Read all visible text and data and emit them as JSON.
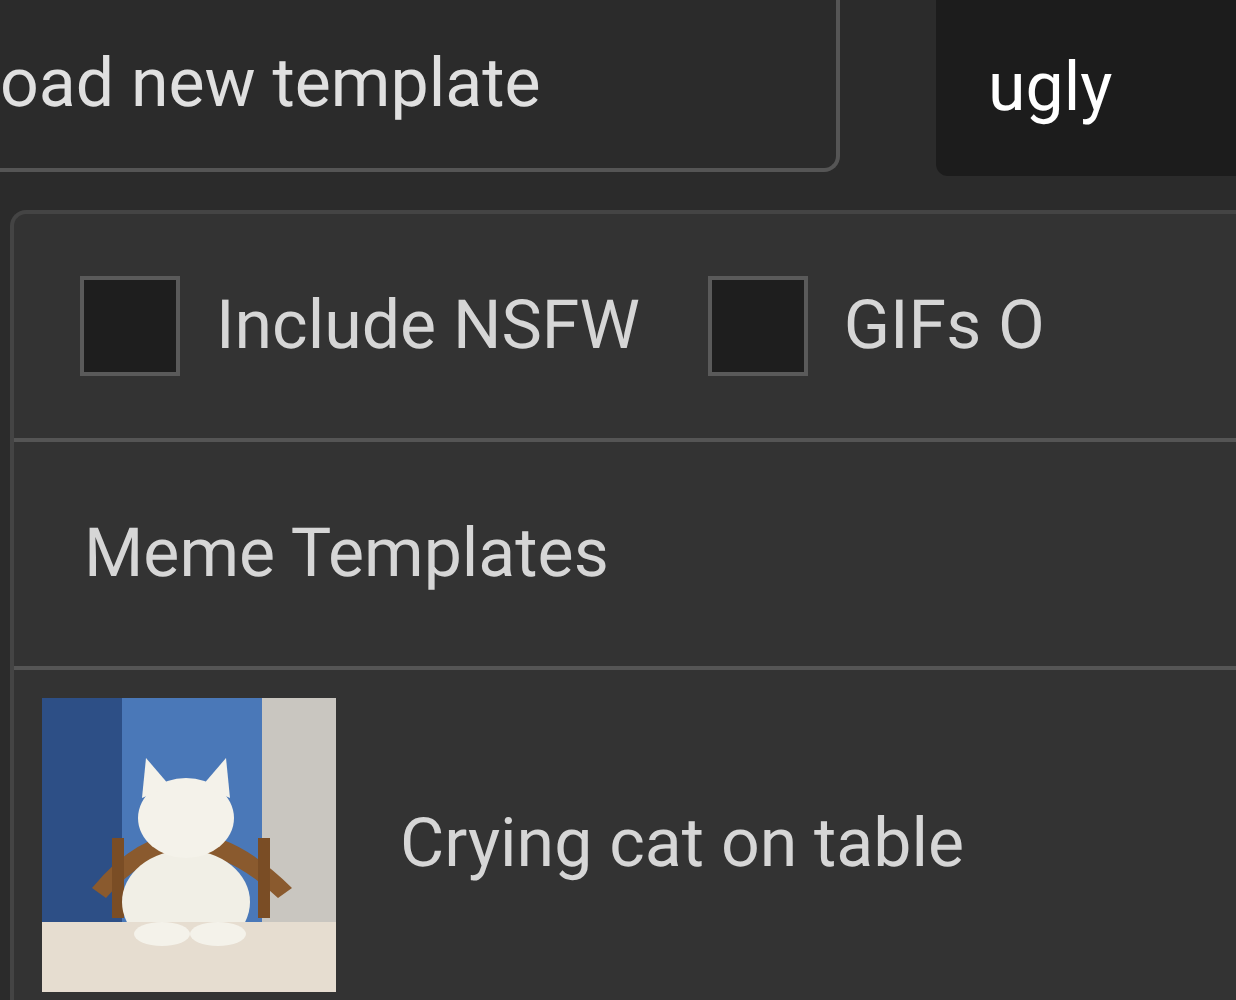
{
  "upload_button": {
    "label": "oad new template"
  },
  "search": {
    "value": "ugly"
  },
  "filters": [
    {
      "label": "Include NSFW",
      "checked": false
    },
    {
      "label": "GIFs O",
      "checked": false
    }
  ],
  "section": {
    "title": "Meme Templates"
  },
  "templates": [
    {
      "kind": "picture",
      "label": "Crying cat on table"
    }
  ]
}
